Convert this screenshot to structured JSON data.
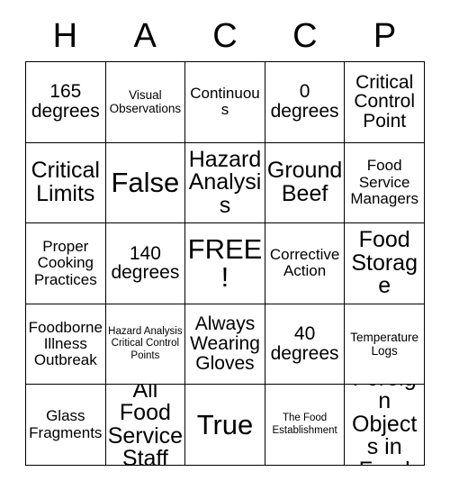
{
  "card": {
    "header_letters": [
      "H",
      "A",
      "C",
      "C",
      "P"
    ],
    "rows": [
      [
        {
          "text": "165 degrees",
          "size": "lg"
        },
        {
          "text": "Visual Observations",
          "size": "sm"
        },
        {
          "text": "Continuous",
          "size": "md"
        },
        {
          "text": "0 degrees",
          "size": "lg"
        },
        {
          "text": "Critical Control Point",
          "size": "lg"
        }
      ],
      [
        {
          "text": "Critical Limits",
          "size": "xl"
        },
        {
          "text": "False",
          "size": "xxl"
        },
        {
          "text": "Hazard Analysis",
          "size": "xl"
        },
        {
          "text": "Ground Beef",
          "size": "xl"
        },
        {
          "text": "Food Service Managers",
          "size": "md"
        }
      ],
      [
        {
          "text": "Proper Cooking Practices",
          "size": "md"
        },
        {
          "text": "140 degrees",
          "size": "lg"
        },
        {
          "text": "FREE!",
          "size": "xxl"
        },
        {
          "text": "Corrective Action",
          "size": "md"
        },
        {
          "text": "Food Storage",
          "size": "xl"
        }
      ],
      [
        {
          "text": "Foodborne Illness Outbreak",
          "size": "md"
        },
        {
          "text": "Hazard Analysis Critical Control Points",
          "size": "xs"
        },
        {
          "text": "Always Wearing Gloves",
          "size": "lg"
        },
        {
          "text": "40 degrees",
          "size": "lg"
        },
        {
          "text": "Temperature Logs",
          "size": "sm"
        }
      ],
      [
        {
          "text": "Glass Fragments",
          "size": "md"
        },
        {
          "text": "All Food Service Staff",
          "size": "xl"
        },
        {
          "text": "True",
          "size": "xxl"
        },
        {
          "text": "The Food Establishment",
          "size": "xs"
        },
        {
          "text": "Foreign Objects in Food",
          "size": "xl"
        }
      ]
    ]
  },
  "colors": {
    "background": "#ffffff",
    "text": "#000000",
    "border": "#000000"
  }
}
